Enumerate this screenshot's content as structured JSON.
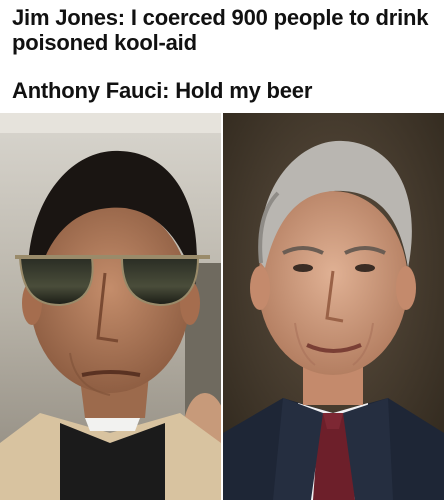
{
  "meme": {
    "caption_1": "Jim Jones: I coerced 900 people to drink poisoned kool-aid",
    "caption_2": "Anthony Fauci: Hold my beer",
    "left_image": {
      "depicts": "jim-jones-portrait"
    },
    "right_image": {
      "depicts": "anthony-fauci-portrait"
    }
  },
  "colors": {
    "text": "#111111",
    "background": "#ffffff"
  }
}
